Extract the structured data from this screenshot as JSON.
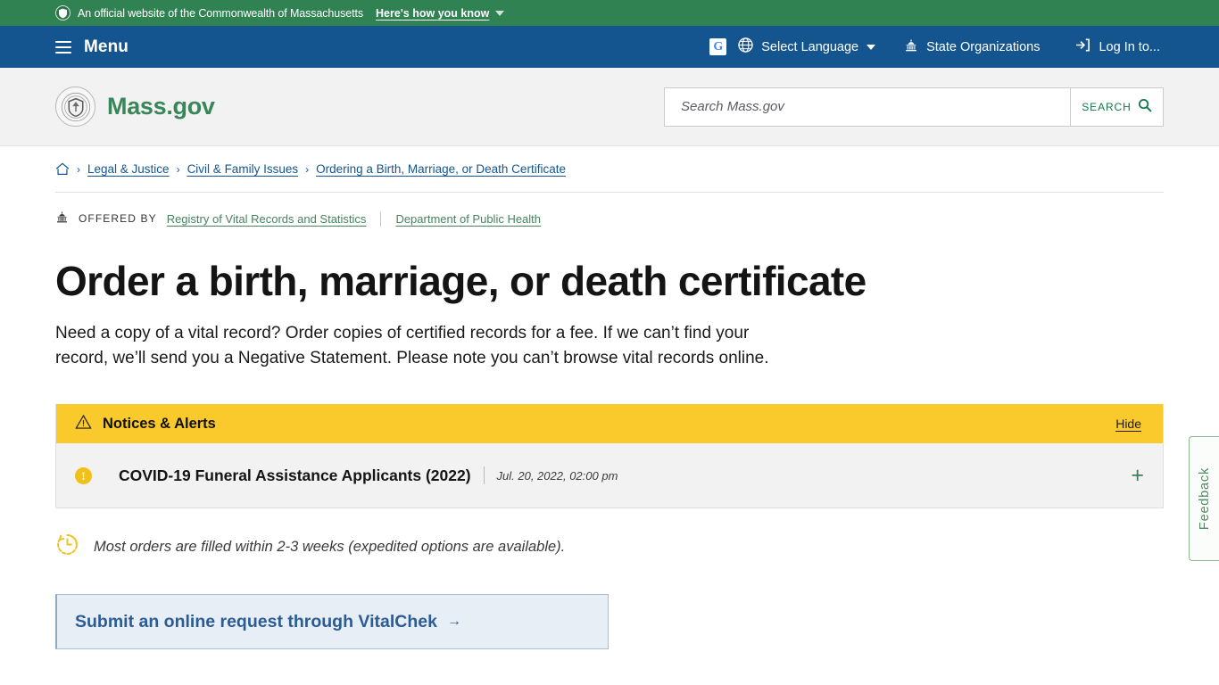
{
  "gov_banner": {
    "seal_icon": "state-seal-icon",
    "text": "An official website of the Commonwealth of Massachusetts",
    "how_you_know": "Here's how you know",
    "caret_icon": "chevron-down-icon"
  },
  "util_nav": {
    "menu_icon": "hamburger-icon",
    "menu_label": "Menu",
    "google_badge": "G",
    "globe_icon": "globe-icon",
    "select_language": "Select Language",
    "language_caret_icon": "chevron-down-icon",
    "capitol_icon": "capitol-building-icon",
    "state_organizations": "State Organizations",
    "login_icon": "login-arrow-icon",
    "log_in": "Log In to..."
  },
  "header": {
    "logo_icon": "mass-state-seal-icon",
    "brand": "Mass.gov",
    "search": {
      "placeholder": "Search Mass.gov",
      "value": "",
      "button_label": "SEARCH",
      "button_icon": "magnifier-icon"
    }
  },
  "breadcrumb": {
    "home_icon": "home-icon",
    "separator": "›",
    "items": [
      {
        "label": "Legal & Justice"
      },
      {
        "label": "Civil & Family Issues"
      },
      {
        "label": "Ordering a Birth, Marriage, or Death Certificate"
      }
    ]
  },
  "offered_by": {
    "icon": "capitol-building-icon",
    "label": "OFFERED BY",
    "orgs": [
      {
        "label": "Registry of Vital Records and Statistics"
      },
      {
        "label": "Department of Public Health"
      }
    ]
  },
  "main": {
    "title": "Order a birth, marriage, or death certificate",
    "description": "Need a copy of a vital record? Order copies of certified records for a fee. If we can’t find your record, we’ll send you a Negative Statement. Please note you can’t browse vital records online."
  },
  "alerts": {
    "warning_icon": "warning-triangle-icon",
    "heading": "Notices & Alerts",
    "hide_label": "Hide",
    "items": [
      {
        "status_icon": "exclamation-circle-icon",
        "title": "COVID-19 Funeral Assistance Applicants (2022)",
        "date": "Jul. 20, 2022, 02:00 pm",
        "expand_icon": "plus-icon",
        "expand_label": "+"
      }
    ]
  },
  "timing_note": {
    "icon": "clock-icon",
    "text": "Most orders are filled within 2-3 weeks (expedited options are available)."
  },
  "cta": {
    "label": "Submit an online request through VitalChek",
    "arrow_icon": "arrow-right-icon",
    "arrow_glyph": "→"
  },
  "feedback_tab": {
    "label": "Feedback"
  },
  "colors": {
    "banner_green": "#308252",
    "nav_blue": "#14558f",
    "brand_green": "#388659",
    "alert_yellow": "#fac92c",
    "link_blue": "#14558f",
    "cta_blue": "#2b5c94"
  }
}
